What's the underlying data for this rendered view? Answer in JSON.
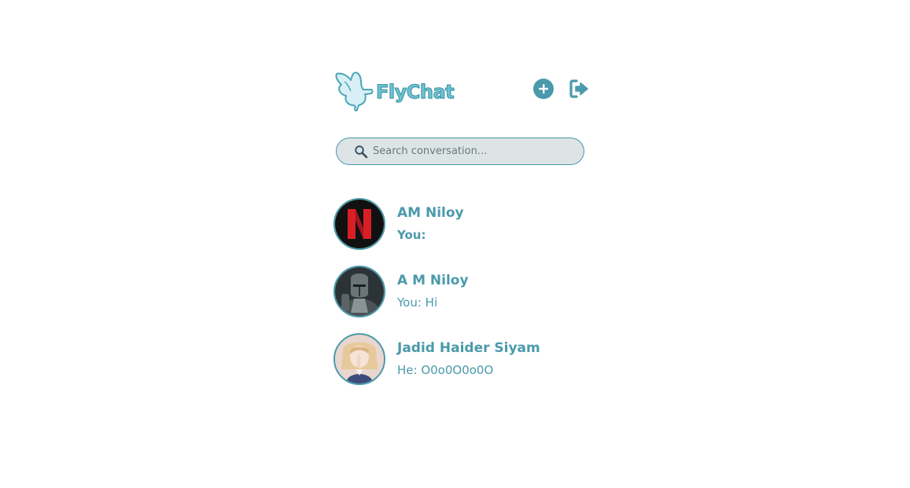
{
  "header": {
    "app_name": "FlyChat",
    "logo_icon": "bird-icon",
    "add_icon": "plus-circle-icon",
    "logout_icon": "logout-icon"
  },
  "search": {
    "placeholder": "Search conversation...",
    "icon": "magnifier-icon"
  },
  "conversations": [
    {
      "name": "AM Niloy",
      "preview": "You:",
      "unread": true
    },
    {
      "name": "A M Niloy",
      "preview": "You: Hi",
      "unread": false
    },
    {
      "name": "Jadid Haider Siyam",
      "preview": "He: O0o0O0o0O",
      "unread": false
    }
  ],
  "colors": {
    "accent": "#4a9aab",
    "search_bg": "#dde4e6",
    "logo_fill": "#6cc3d3"
  }
}
